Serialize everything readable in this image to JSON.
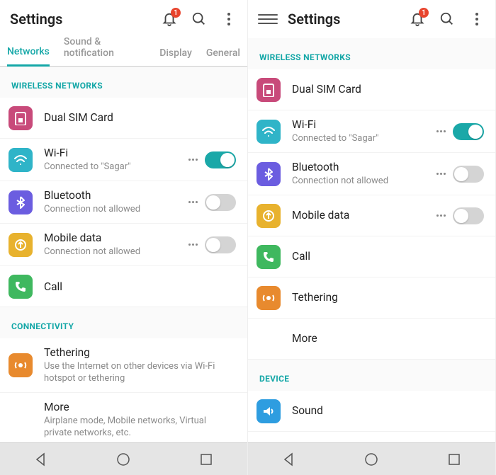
{
  "left": {
    "header": {
      "title": "Settings",
      "badge": "1"
    },
    "tabs": [
      {
        "label": "Networks",
        "active": true
      },
      {
        "label": "Sound & notification",
        "active": false
      },
      {
        "label": "Display",
        "active": false
      },
      {
        "label": "General",
        "active": false
      }
    ],
    "sections": [
      {
        "header": "WIRELESS NETWORKS",
        "rows": [
          {
            "icon": "sim",
            "color": "pink",
            "title": "Dual SIM Card"
          },
          {
            "icon": "wifi",
            "color": "teal",
            "title": "Wi-Fi",
            "sub": "Connected to \"Sagar\"",
            "dots": true,
            "toggle": "on"
          },
          {
            "icon": "bluetooth",
            "color": "purple",
            "title": "Bluetooth",
            "sub": "Connection not allowed",
            "dots": true,
            "toggle": "off"
          },
          {
            "icon": "data",
            "color": "gold",
            "title": "Mobile data",
            "sub": "Connection not allowed",
            "dots": true,
            "toggle": "off"
          },
          {
            "icon": "call",
            "color": "green",
            "title": "Call"
          }
        ]
      },
      {
        "header": "CONNECTIVITY",
        "rows": [
          {
            "icon": "tether",
            "color": "orange",
            "title": "Tethering",
            "sub": "Use the Internet on other devices via Wi-Fi hotspot or tethering"
          },
          {
            "icon": "",
            "color": "",
            "title": "More",
            "sub": "Airplane mode, Mobile networks, Virtual private networks, etc."
          }
        ]
      }
    ]
  },
  "right": {
    "header": {
      "title": "Settings",
      "badge": "1"
    },
    "sections": [
      {
        "header": "WIRELESS NETWORKS",
        "rows": [
          {
            "icon": "sim",
            "color": "pink",
            "title": "Dual SIM Card"
          },
          {
            "icon": "wifi",
            "color": "teal",
            "title": "Wi-Fi",
            "sub": "Connected to \"Sagar\"",
            "dots": true,
            "toggle": "on"
          },
          {
            "icon": "bluetooth",
            "color": "purple",
            "title": "Bluetooth",
            "sub": "Connection not allowed",
            "dots": true,
            "toggle": "off"
          },
          {
            "icon": "data",
            "color": "gold",
            "title": "Mobile data",
            "dots": true,
            "toggle": "off"
          },
          {
            "icon": "call",
            "color": "green",
            "title": "Call"
          },
          {
            "icon": "tether",
            "color": "orange",
            "title": "Tethering"
          },
          {
            "icon": "",
            "color": "",
            "title": "More"
          }
        ]
      },
      {
        "header": "DEVICE",
        "rows": [
          {
            "icon": "sound",
            "color": "blue",
            "title": "Sound"
          }
        ]
      }
    ]
  },
  "icons": {
    "sim": "<rect x='3' y='2' width='14' height='18' rx='2' fill='none' stroke='white' stroke-width='2'/><rect x='7' y='10' width='6' height='6' fill='white'/>",
    "wifi": "<path d='M2 8 Q10 0 18 8 M5 12 Q10 7 15 12 M10 16 L10 16' fill='none' stroke='white' stroke-width='2' stroke-linecap='round'/>",
    "bluetooth": "<path d='M10 2 L10 18 L15 13 L5 7 M10 2 L15 7 L5 13' fill='none' stroke='white' stroke-width='2' stroke-linejoin='round'/>",
    "data": "<circle cx='10' cy='10' r='7' fill='none' stroke='white' stroke-width='2'/><path d='M10 6 L10 14 M7 9 L10 6 L13 9' fill='none' stroke='white' stroke-width='2'/>",
    "call": "<path d='M5 3 Q3 3 3 5 Q3 15 15 17 Q17 17 17 15 L17 12 L13 11 L11 13 Q7 11 7 7 L9 5 L8 3 Z' fill='white'/>",
    "tether": "<circle cx='10' cy='10' r='3' fill='white'/><path d='M4 6 A7 7 0 0 0 4 14 M16 6 A7 7 0 0 1 16 14' fill='none' stroke='white' stroke-width='2'/>",
    "sound": "<path d='M3 8 L7 8 L12 4 L12 16 L7 12 L3 12 Z' fill='white'/><path d='M14 7 Q17 10 14 13' fill='none' stroke='white' stroke-width='2'/>"
  }
}
